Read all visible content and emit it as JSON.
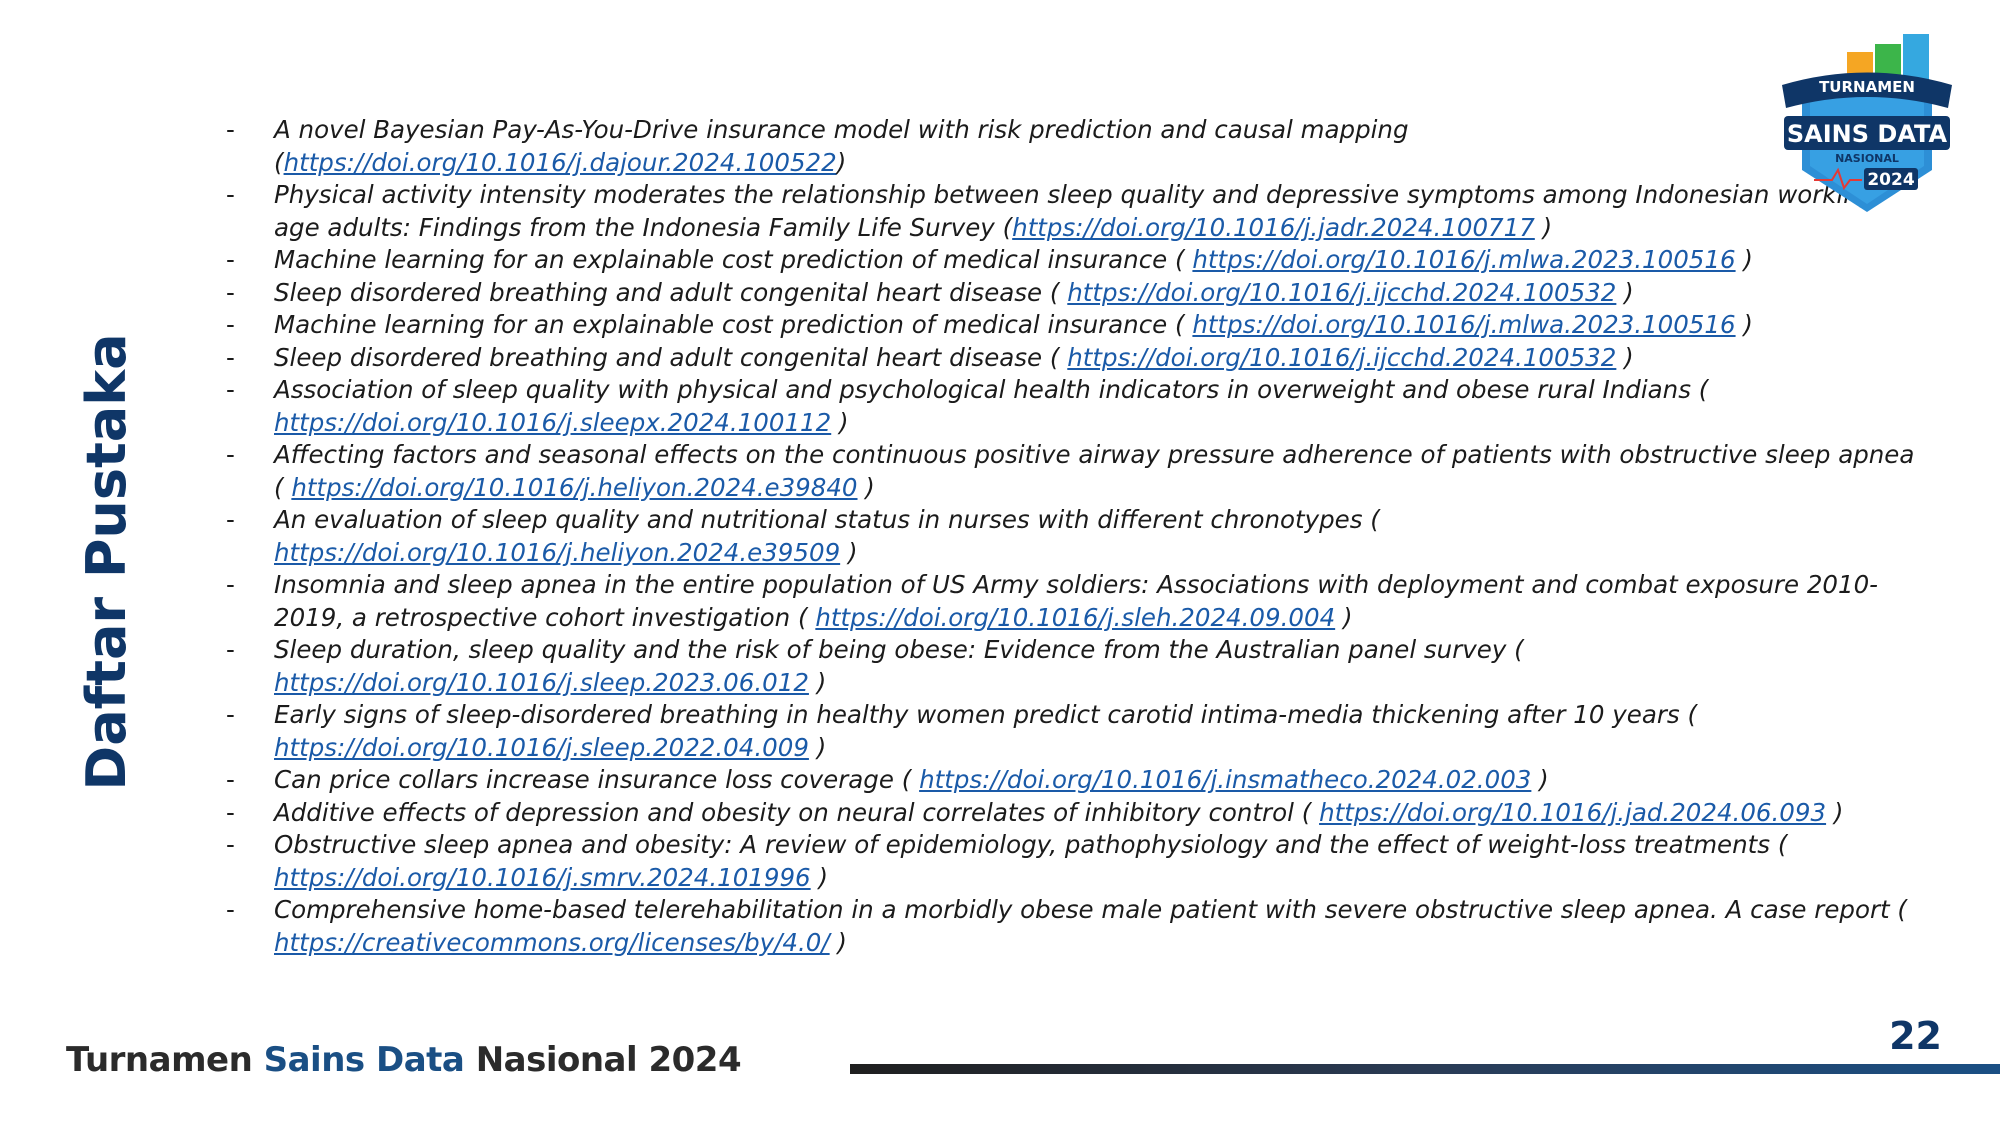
{
  "slide": {
    "side_title": "Daftar Pustaka",
    "page_number": "22",
    "footer": {
      "part1": "Turnamen ",
      "part2": "Sains Data ",
      "part3": "Nasional 2024"
    },
    "logo": {
      "line1": "TURNAMEN",
      "line2": "SAINS DATA",
      "line3": "NASIONAL",
      "year": "2024"
    }
  },
  "references": [
    {
      "text": "A novel Bayesian Pay-As-You-Drive insurance model with risk prediction and causal mapping",
      "pre": " (",
      "link": "https://doi.org/10.1016/j.dajour.2024.100522",
      "post": ")"
    },
    {
      "text": "Physical activity intensity moderates the relationship between sleep quality and depressive symptoms among Indonesian working-age adults: Findings from the Indonesia Family Life Survey",
      "pre": " (",
      "link": "https://doi.org/10.1016/j.jadr.2024.100717",
      "post": " )"
    },
    {
      "text": "Machine learning for an explainable cost prediction of medical insurance",
      "pre": " ( ",
      "link": "https://doi.org/10.1016/j.mlwa.2023.100516",
      "post": " )"
    },
    {
      "text": "Sleep disordered breathing and adult congenital heart disease",
      "pre": " ( ",
      "link": "https://doi.org/10.1016/j.ijcchd.2024.100532",
      "post": " )"
    },
    {
      "text": "Machine learning for an explainable cost prediction of medical insurance",
      "pre": " ( ",
      "link": "https://doi.org/10.1016/j.mlwa.2023.100516",
      "post": " )"
    },
    {
      "text": "Sleep disordered breathing and adult congenital heart disease",
      "pre": " ( ",
      "link": "https://doi.org/10.1016/j.ijcchd.2024.100532",
      "post": " )"
    },
    {
      "text": "Association of sleep quality with physical and psychological health indicators in overweight and obese rural Indians",
      "pre": " ( ",
      "link": "https://doi.org/10.1016/j.sleepx.2024.100112",
      "post": " )"
    },
    {
      "text": "Affecting factors and seasonal effects on the continuous positive airway pressure adherence of patients with obstructive sleep apnea",
      "pre": " ( ",
      "link": "https://doi.org/10.1016/j.heliyon.2024.e39840",
      "post": " )"
    },
    {
      "text": "An evaluation of sleep quality and nutritional status in nurses with different chronotypes",
      "pre": " ( ",
      "link": "https://doi.org/10.1016/j.heliyon.2024.e39509",
      "post": " )"
    },
    {
      "text": "Insomnia and sleep apnea in the entire population of US Army soldiers: Associations with deployment and combat exposure 2010-2019, a retrospective cohort investigation",
      "pre": " ( ",
      "link": "https://doi.org/10.1016/j.sleh.2024.09.004",
      "post": " )"
    },
    {
      "text": "Sleep duration, sleep quality and the risk of being obese: Evidence from the Australian panel survey",
      "pre": " ( ",
      "link": "https://doi.org/10.1016/j.sleep.2023.06.012",
      "post": " )"
    },
    {
      "text": "Early signs of sleep-disordered breathing in healthy women predict carotid intima-media thickening after 10 years",
      "pre": " ( ",
      "link": "https://doi.org/10.1016/j.sleep.2022.04.009",
      "post": " )"
    },
    {
      "text": "Can price collars increase insurance loss coverage",
      "pre": " ( ",
      "link": "https://doi.org/10.1016/j.insmatheco.2024.02.003",
      "post": " )"
    },
    {
      "text": "Additive effects of depression and obesity on neural correlates of inhibitory control",
      "pre": " ( ",
      "link": "https://doi.org/10.1016/j.jad.2024.06.093",
      "post": " )"
    },
    {
      "text": "Obstructive sleep apnea and obesity: A review of epidemiology, pathophysiology and the effect of weight-loss treatments",
      "pre": " ( ",
      "link": "https://doi.org/10.1016/j.smrv.2024.101996",
      "post": " )"
    },
    {
      "text": "Comprehensive home-based telerehabilitation in a morbidly obese male patient with severe obstructive sleep apnea. A case report",
      "pre": " ( ",
      "link": "https://creativecommons.org/licenses/by/4.0/",
      "post": " )"
    }
  ]
}
